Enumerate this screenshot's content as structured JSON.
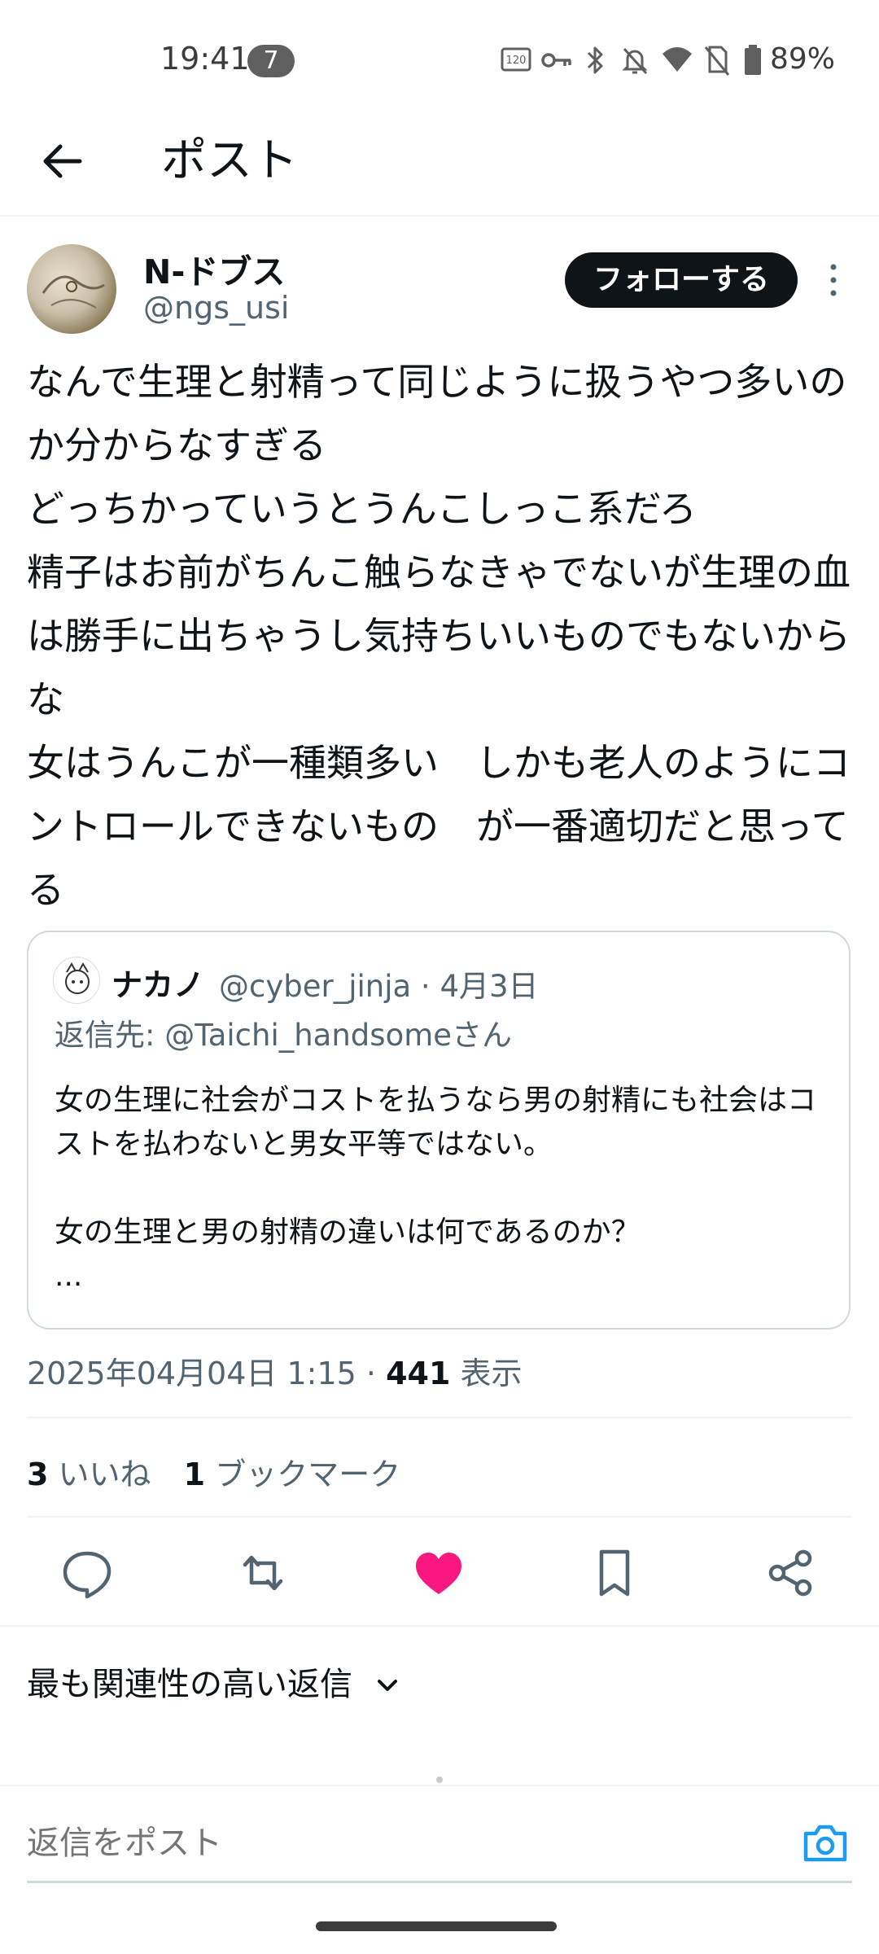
{
  "status_bar": {
    "time": "19:41",
    "notification_count": "7",
    "battery": "89%",
    "icons": [
      "120hz-icon",
      "vpn-key-icon",
      "bluetooth-icon",
      "mute-icon",
      "wifi-icon",
      "no-sim-icon",
      "battery-icon"
    ]
  },
  "header": {
    "title": "ポスト"
  },
  "post": {
    "author_name": "N-ドブス",
    "author_handle": "@ngs_usi",
    "follow_label": "フォローする",
    "text": "なんで生理と射精って同じように扱うやつ多いのか分からなすぎる\nどっちかっていうとうんこしっこ系だろ\n精子はお前がちんこ触らなきゃでないが生理の血は勝手に出ちゃうし気持ちいいものでもないからな\n女はうんこが一種類多い　しかも老人のようにコントロールできないもの　が一番適切だと思ってる",
    "timestamp": "2025年04月04日 1:15",
    "views_count": "441",
    "views_label": "表示",
    "likes_count": "3",
    "likes_label": "いいね",
    "bookmarks_count": "1",
    "bookmarks_label": "ブックマーク"
  },
  "quote": {
    "author_name": "ナカノ",
    "meta": "@cyber_jinja · 4月3日",
    "reply_to": "返信先: @Taichi_handsomeさん",
    "text": "女の生理に社会がコストを払うなら男の射精にも社会はコストを払わないと男女平等ではない。\n\n女の生理と男の射精の違いは何であるのか？\n..."
  },
  "actions": {
    "reply_icon": "reply-icon",
    "retweet_icon": "retweet-icon",
    "like_icon": "heart-icon",
    "bookmark_icon": "bookmark-icon",
    "share_icon": "share-icon",
    "like_color": "#f91880"
  },
  "replies": {
    "sort_label": "最も関連性の高い返信"
  },
  "composer": {
    "placeholder": "返信をポスト"
  },
  "colors": {
    "primary_text": "#0f1419",
    "secondary_text": "#536471",
    "accent_blue": "#1d9bf0"
  }
}
